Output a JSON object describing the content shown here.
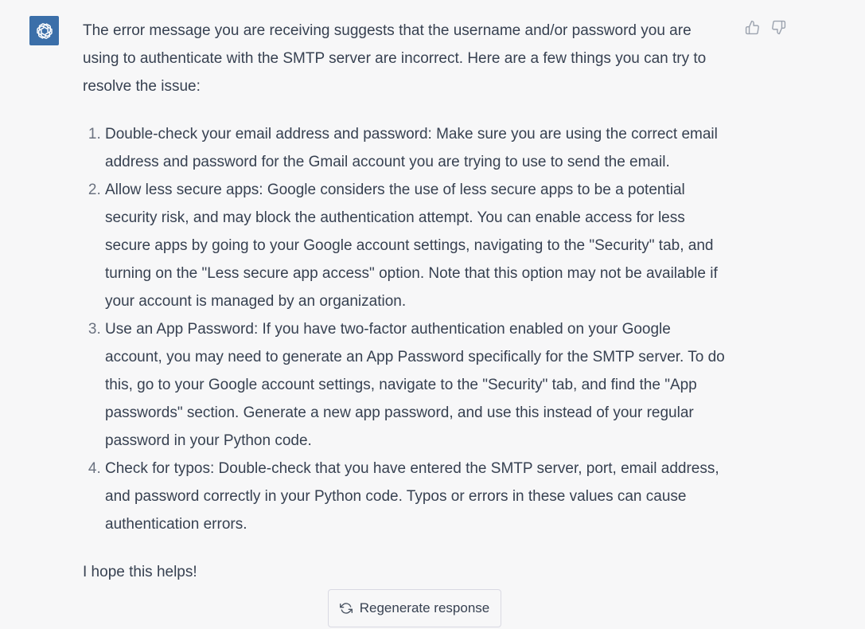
{
  "assistant": {
    "avatar_icon": "openai-logo-icon",
    "avatar_color": "#3b6fa9"
  },
  "message": {
    "intro": "The error message you are receiving suggests that the username and/or password you are using to authenticate with the SMTP server are incorrect. Here are a few things you can try to resolve the issue:",
    "steps": [
      "Double-check your email address and password: Make sure you are using the correct email address and password for the Gmail account you are trying to use to send the email.",
      "Allow less secure apps: Google considers the use of less secure apps to be a potential security risk, and may block the authentication attempt. You can enable access for less secure apps by going to your Google account settings, navigating to the \"Security\" tab, and turning on the \"Less secure app access\" option. Note that this option may not be available if your account is managed by an organization.",
      "Use an App Password: If you have two-factor authentication enabled on your Google account, you may need to generate an App Password specifically for the SMTP server. To do this, go to your Google account settings, navigate to the \"Security\" tab, and find the \"App passwords\" section. Generate a new app password, and use this instead of your regular password in your Python code.",
      "Check for typos: Double-check that you have entered the SMTP server, port, email address, and password correctly in your Python code. Typos or errors in these values can cause authentication errors."
    ],
    "closing": "I hope this helps!"
  },
  "feedback": {
    "thumbs_up_icon": "thumbs-up-icon",
    "thumbs_down_icon": "thumbs-down-icon"
  },
  "regenerate": {
    "icon": "refresh-icon",
    "label": "Regenerate response"
  }
}
